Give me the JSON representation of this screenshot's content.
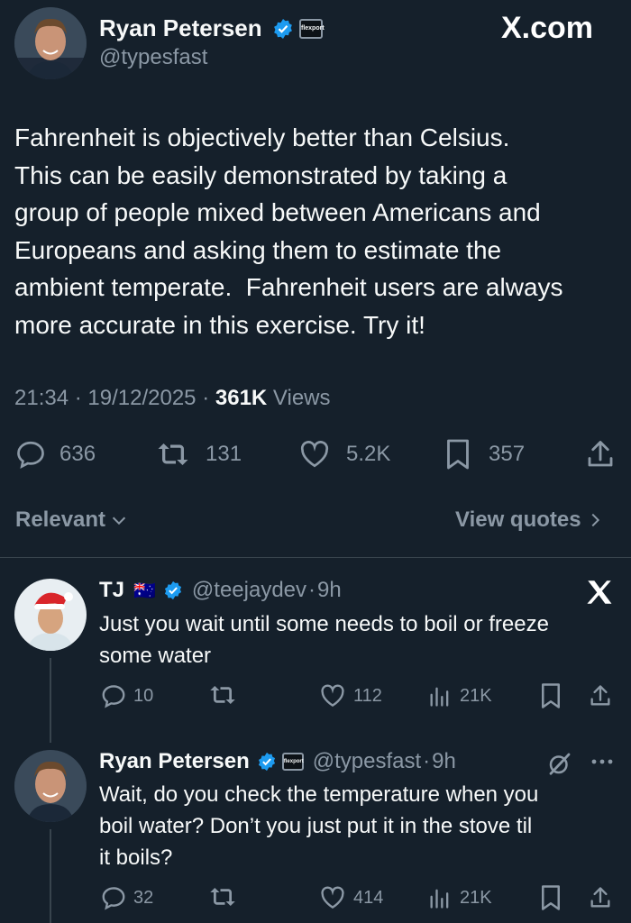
{
  "brand": {
    "watermark": "X.com"
  },
  "main_tweet": {
    "author_name": "Ryan Petersen",
    "handle": "@typesfast",
    "org_badge": "flexport",
    "text_lines": [
      "Fahrenheit is objectively better than Celsius.",
      "This can be easily demonstrated by taking a",
      "group of people mixed between Americans and",
      "Europeans and asking them to estimate the",
      "ambient temperate.  Fahrenheit users are always",
      "more accurate in this exercise. Try it!"
    ],
    "time": "21:34",
    "date": "19/12/2025",
    "views_count": "361K",
    "views_label": "Views",
    "separator": "·",
    "stats": {
      "replies": "636",
      "reposts": "131",
      "likes": "5.2K",
      "bookmarks": "357"
    }
  },
  "filters": {
    "sort_label": "Relevant",
    "quotes_label": "View quotes"
  },
  "replies": [
    {
      "author_name": "TJ",
      "flag": "🇦🇺",
      "handle": "@teejaydev",
      "age": "9h",
      "text_lines": [
        "Just you wait until some needs to boil or freeze",
        "some water"
      ],
      "stats": {
        "replies": "10",
        "likes": "112",
        "views": "21K"
      }
    },
    {
      "author_name": "Ryan Petersen",
      "org_badge": "flexport",
      "handle": "@typesfast",
      "age": "9h",
      "text_lines": [
        "Wait, do you check the temperature when you",
        "boil water? Don’t you just put it in the stove til",
        "it boils?"
      ],
      "stats": {
        "replies": "32",
        "likes": "414",
        "views": "21K"
      }
    }
  ],
  "colors": {
    "background": "#15202b",
    "text": "#f7f9f9",
    "muted": "#8b98a5",
    "verified": "#1d9bf0",
    "divider": "#38444d"
  }
}
